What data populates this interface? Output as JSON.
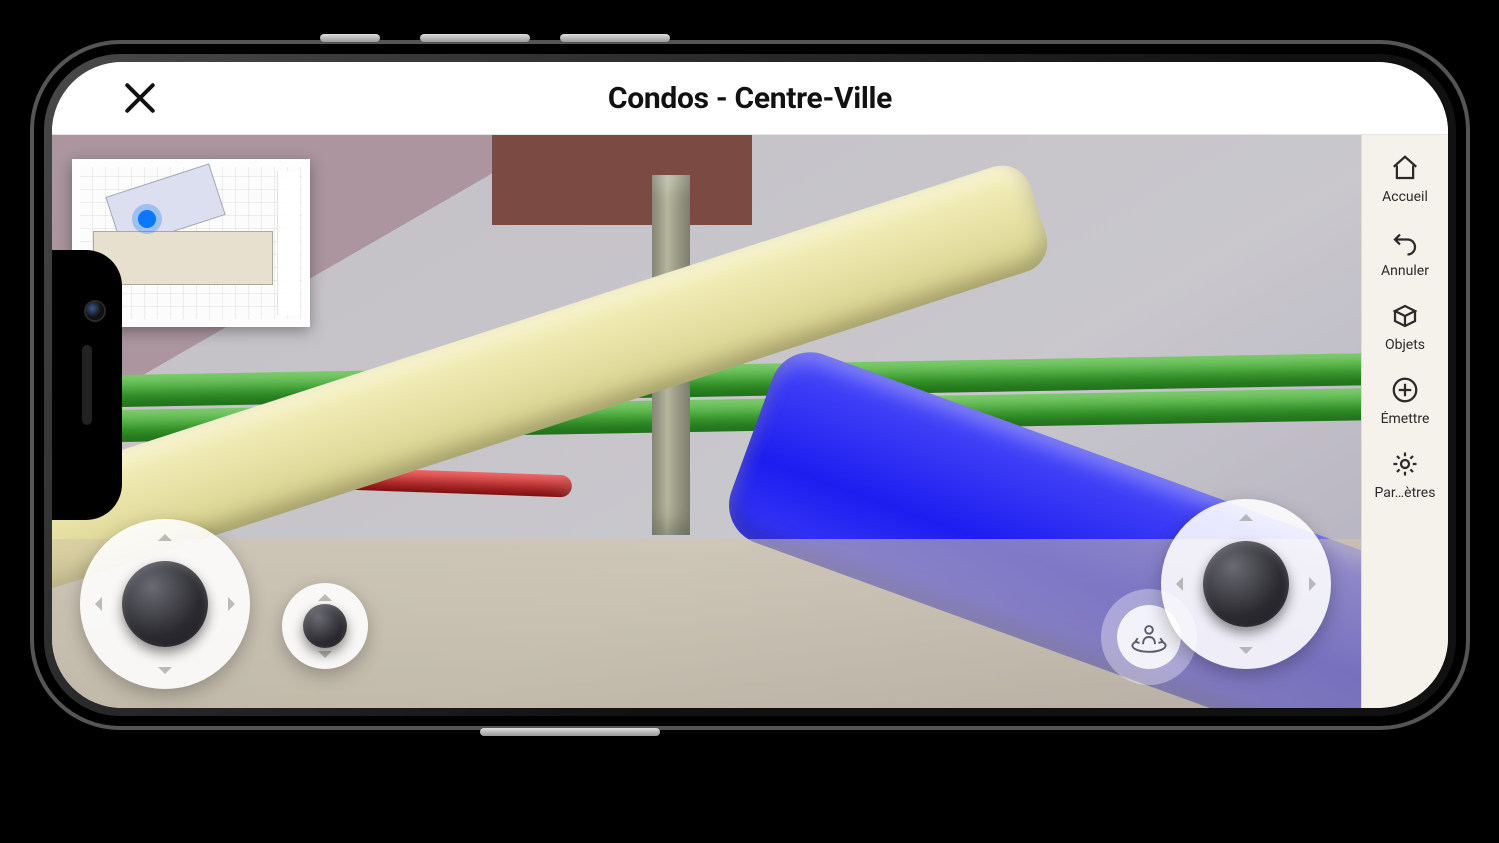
{
  "header": {
    "title": "Condos - Centre-Ville"
  },
  "sidebar": {
    "items": [
      {
        "label": "Accueil",
        "icon": "home-icon"
      },
      {
        "label": "Annuler",
        "icon": "undo-icon"
      },
      {
        "label": "Objets",
        "icon": "objects-icon"
      },
      {
        "label": "Émettre",
        "icon": "plus-circle-icon"
      },
      {
        "label": "Par…ètres",
        "icon": "gear-icon"
      }
    ]
  },
  "minimap": {
    "marker": {
      "color": "#0a77ff"
    }
  },
  "controls": {
    "left_joystick": "move",
    "vertical_joystick": "elevation",
    "right_joystick": "look",
    "person_mode": "first-person-toggle"
  },
  "viewport": {
    "pipes": {
      "green": "#2fa526",
      "red": "#d01a1a",
      "yellow": "#e9e3a2",
      "blue": "#2424f2",
      "grey": "#8d8d77"
    }
  }
}
